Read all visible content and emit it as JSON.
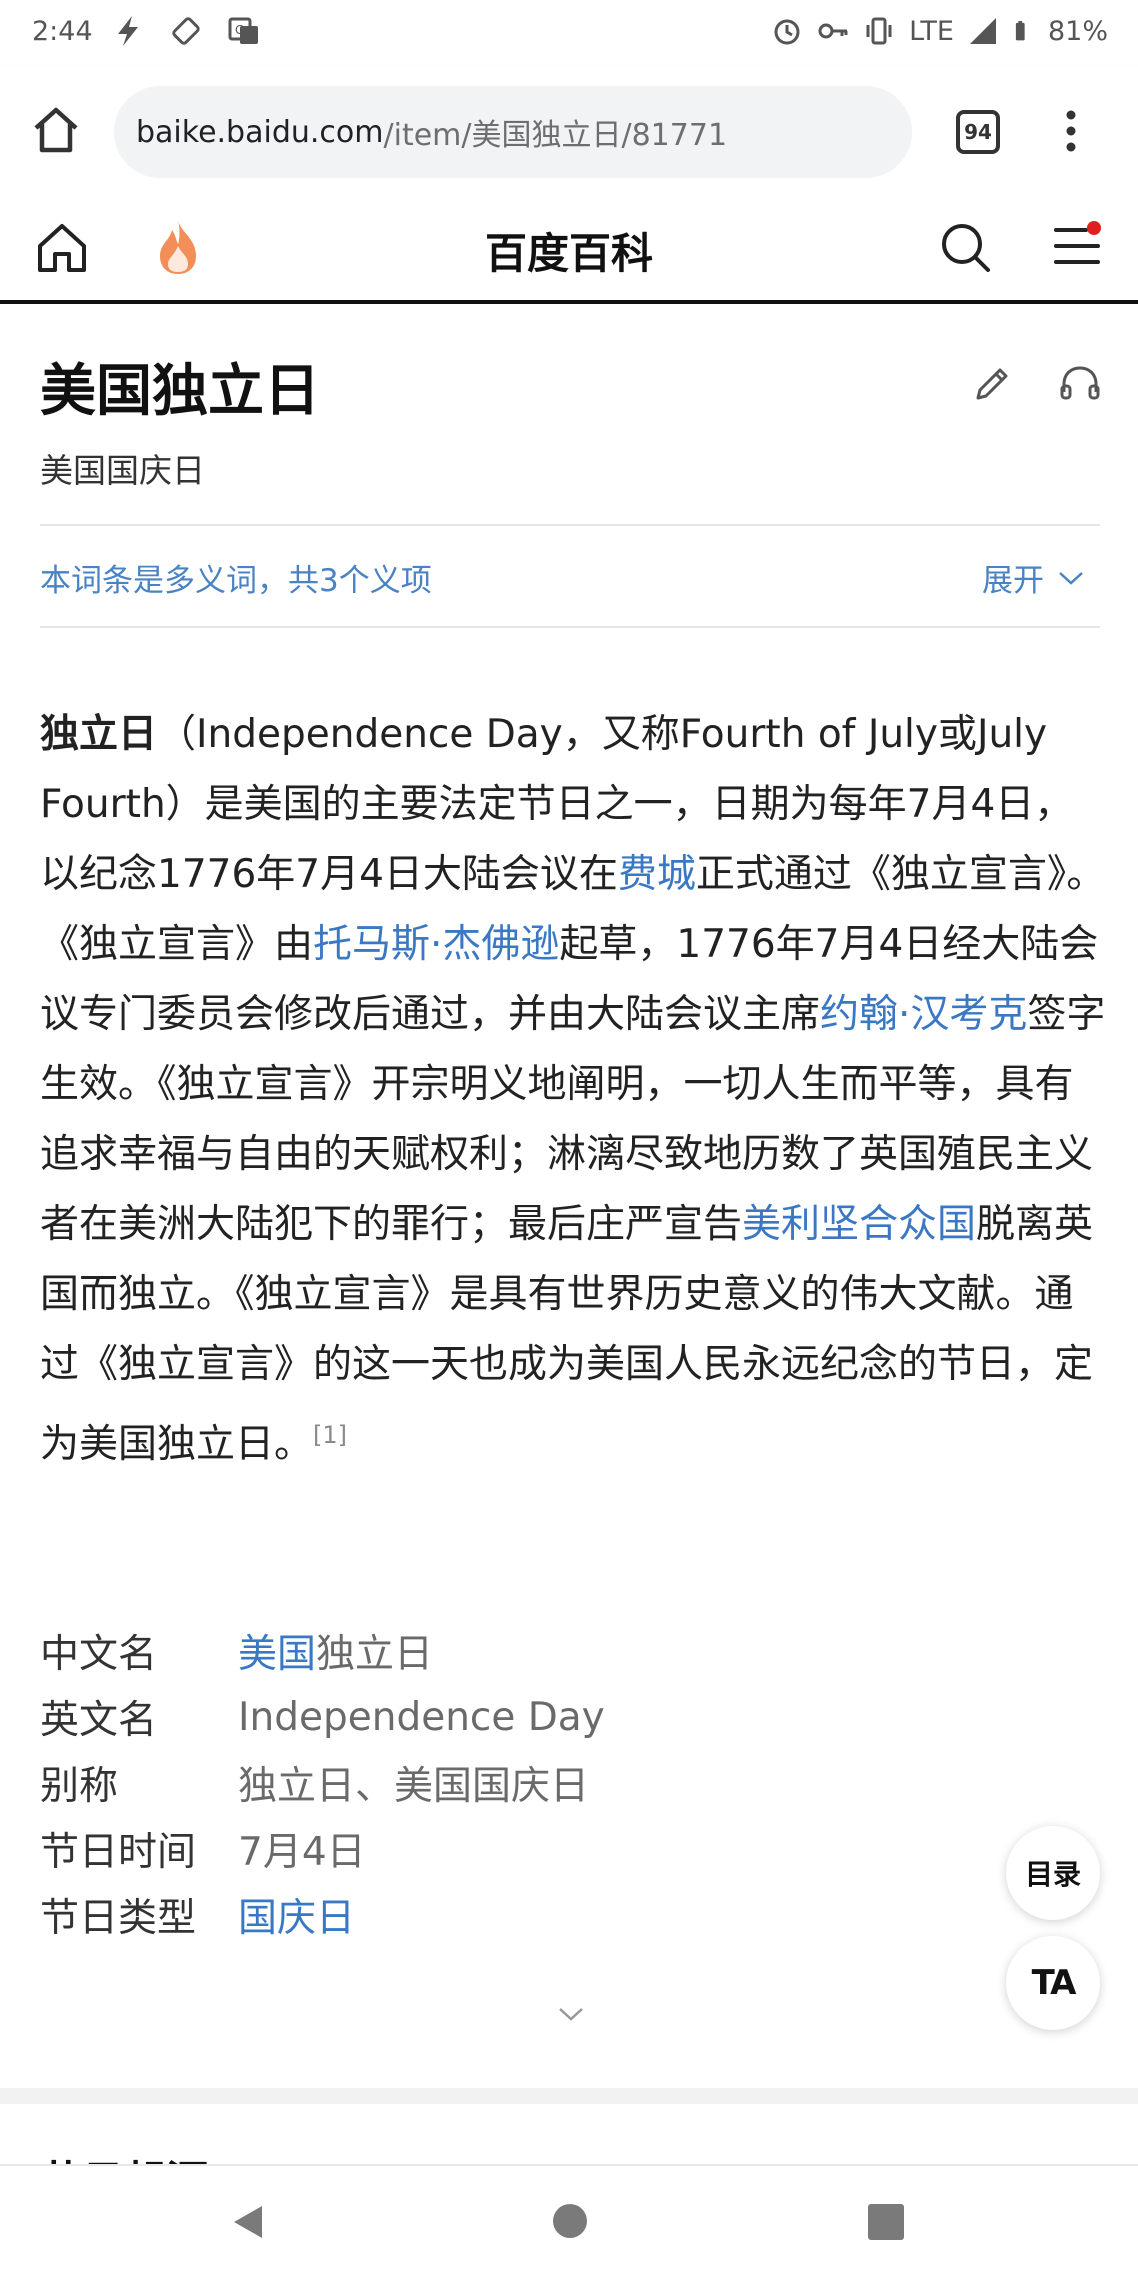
{
  "status_bar": {
    "time": "2:44",
    "network": "LTE",
    "battery": "81%",
    "left_icons": [
      "flash-icon",
      "rotate-icon",
      "translate-icon"
    ],
    "right_icons": [
      "alarm-icon",
      "vpn-key-icon",
      "vibrate-icon",
      "signal-icon",
      "battery-icon"
    ]
  },
  "browser": {
    "url_host": "baike.baidu.com",
    "url_path": "/item/美国独立日/81771",
    "tab_count": "94"
  },
  "site": {
    "title": "百度百科",
    "notification_dot_color": "#e02020"
  },
  "article": {
    "title": "美国独立日",
    "subtitle": "美国国庆日",
    "polysemy_text": "本词条是多义词，共3个义项",
    "expand_label": "展开",
    "paragraph": {
      "term": "独立日",
      "p1": "（Independence Day，又称Fourth of July或July Fourth）是美国的主要法定节日之一，日期为每年7月4日，以纪念1776年7月4日大陆会议在",
      "link1": "费城",
      "p2": "正式通过《独立宣言》。《独立宣言》由",
      "link2": "托马斯·杰佛逊",
      "p3": "起草，1776年7月4日经大陆会议专门委员会修改后通过，并由大陆会议主席",
      "link3": "约翰·汉考克",
      "p4": "签字生效。《独立宣言》开宗明义地阐明，一切人生而平等，具有追求幸福与自由的天赋权利；淋漓尽致地历数了英国殖民主义者在美洲大陆犯下的罪行；最后庄严宣告",
      "link4": "美利坚合众国",
      "p5": "脱离英国而独立。《独立宣言》是具有世界历史意义的伟大文献。通过《独立宣言》的这一天也成为美国人民永远纪念的节日，定为美国独立日。",
      "ref": "[1]"
    },
    "info": {
      "row1_label": "中文名",
      "row1_link": "美国",
      "row1_value": "独立日",
      "row2_label": "英文名",
      "row2_value": "Independence Day",
      "row3_label": "别称",
      "row3_value": "独立日、美国国庆日",
      "row4_label": "节日时间",
      "row4_value": "7月4日",
      "row5_label": "节日类型",
      "row5_link": "国庆日"
    },
    "next_section_heading": "节日起源"
  },
  "floating": {
    "toc_label": "目录",
    "font_label": "TA"
  },
  "colors": {
    "link": "#3a78c3",
    "polysemy": "#4a83c4",
    "flame": "#f07a3a"
  }
}
